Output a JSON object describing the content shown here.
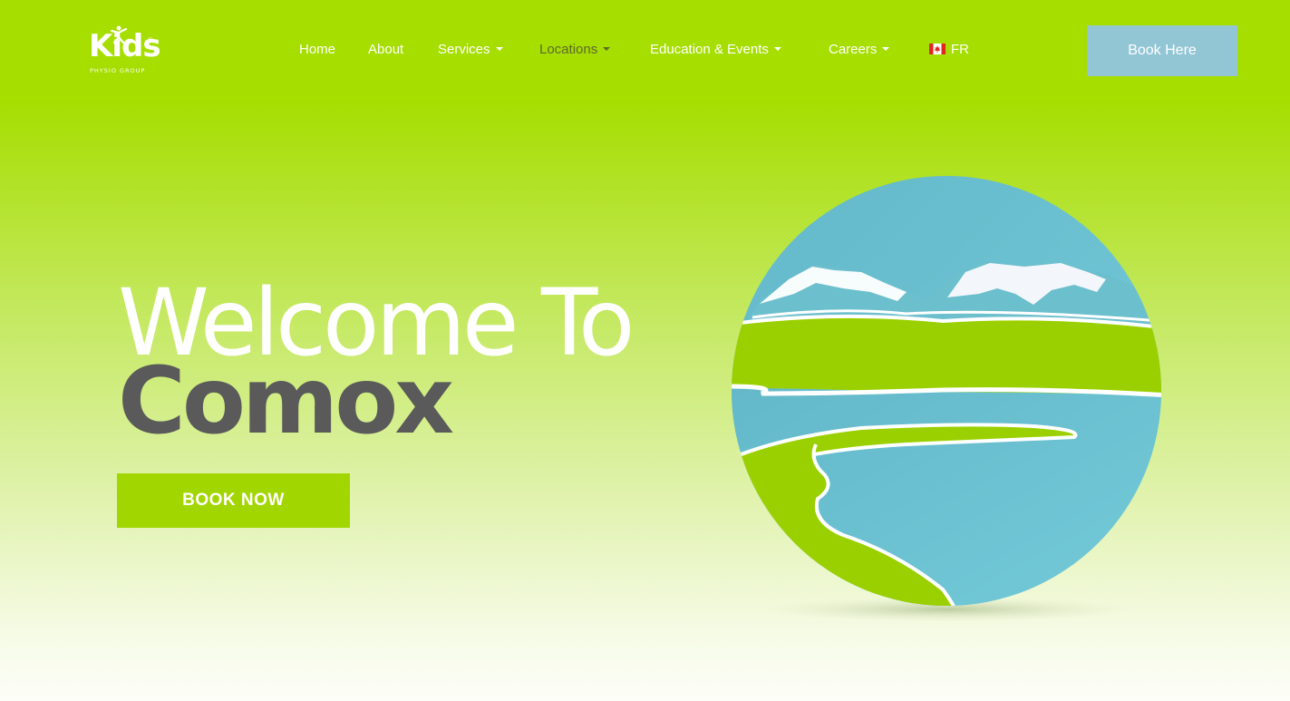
{
  "brand": {
    "logo_text": "Kids",
    "logo_subtext": "PHYSIO GROUP",
    "logo_mark": "®"
  },
  "nav": {
    "items": [
      {
        "label": "Home",
        "has_dropdown": false,
        "active": false
      },
      {
        "label": "About",
        "has_dropdown": false,
        "active": false
      },
      {
        "label": "Services",
        "has_dropdown": true,
        "active": false
      },
      {
        "label": "Locations",
        "has_dropdown": true,
        "active": true
      },
      {
        "label": "Education & Events",
        "has_dropdown": true,
        "active": false
      },
      {
        "label": "Careers",
        "has_dropdown": true,
        "active": false
      }
    ],
    "language": {
      "label": "FR",
      "icon": "canada-flag-icon"
    }
  },
  "header": {
    "book_button_label": "Book Here"
  },
  "hero": {
    "title_line1": "Welcome To",
    "title_line2": "Comox",
    "cta_label": "BOOK NOW"
  },
  "colors": {
    "brand_green": "#a6de00",
    "button_green": "#a2d600",
    "book_here_blue": "#93c6d5",
    "title_gray": "#5a5a5a",
    "water_blue": "#6cc4d3"
  },
  "icons": {
    "illustration": "comox-landscape-illustration"
  }
}
